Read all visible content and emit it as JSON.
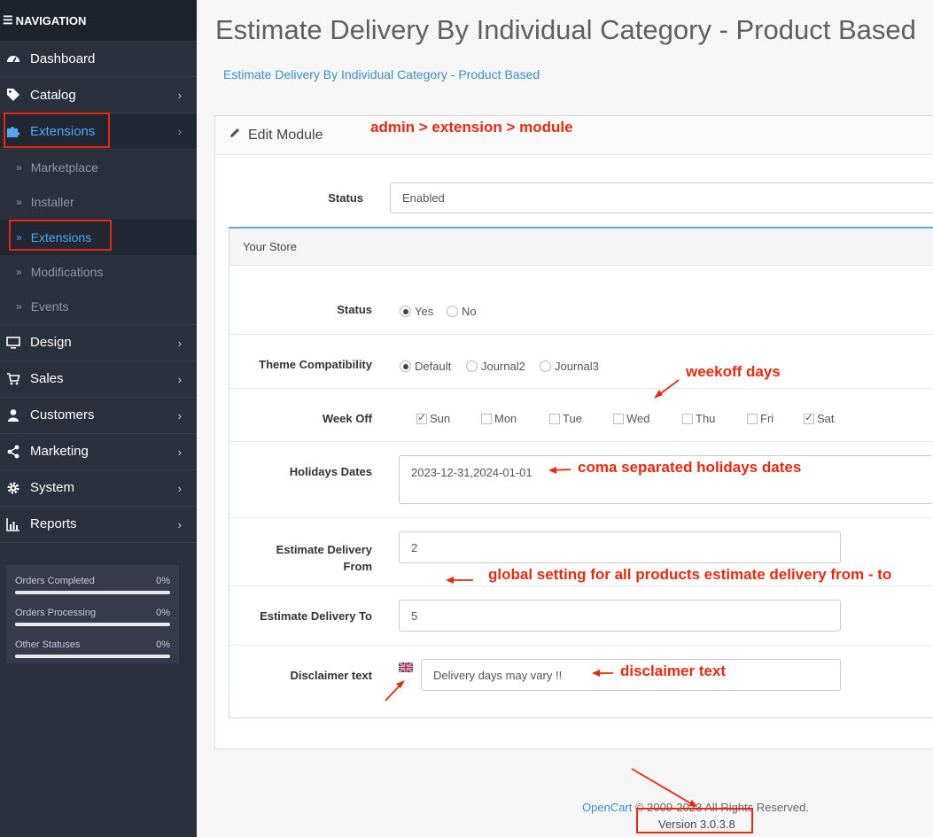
{
  "sidebar": {
    "header": "NAVIGATION",
    "items": [
      {
        "label": "Dashboard",
        "icon": "dashboard-icon"
      },
      {
        "label": "Catalog",
        "icon": "tag-icon"
      },
      {
        "label": "Extensions",
        "icon": "puzzle-icon"
      },
      {
        "label": "Design",
        "icon": "monitor-icon"
      },
      {
        "label": "Sales",
        "icon": "cart-icon"
      },
      {
        "label": "Customers",
        "icon": "user-icon"
      },
      {
        "label": "Marketing",
        "icon": "share-icon"
      },
      {
        "label": "System",
        "icon": "gear-icon"
      },
      {
        "label": "Reports",
        "icon": "bar-chart-icon"
      }
    ],
    "sub_items": [
      "Marketplace",
      "Installer",
      "Extensions",
      "Modifications",
      "Events"
    ],
    "stats": [
      {
        "label": "Orders Completed",
        "value": "0%"
      },
      {
        "label": "Orders Processing",
        "value": "0%"
      },
      {
        "label": "Other Statuses",
        "value": "0%"
      }
    ]
  },
  "page": {
    "title": "Estimate Delivery By Individual Category - Product Based",
    "breadcrumb": "Estimate Delivery By Individual Category - Product Based"
  },
  "panel": {
    "heading": "Edit Module",
    "status_label": "Status",
    "status_value": "Enabled",
    "store_heading": "Your Store"
  },
  "store": {
    "status": {
      "label": "Status",
      "options": [
        "Yes",
        "No"
      ],
      "selected": "Yes"
    },
    "theme": {
      "label": "Theme Compatibility",
      "options": [
        "Default",
        "Journal2",
        "Journal3"
      ],
      "selected": "Default"
    },
    "week_off": {
      "label": "Week Off",
      "days": [
        "Sun",
        "Mon",
        "Tue",
        "Wed",
        "Thu",
        "Fri",
        "Sat"
      ],
      "checked": [
        "Sun",
        "Sat"
      ]
    },
    "holidays": {
      "label": "Holidays Dates",
      "value": "2023-12-31,2024-01-01"
    },
    "from": {
      "label_line1": "Estimate Delivery",
      "label_line2": "From",
      "value": "2"
    },
    "to": {
      "label": "Estimate Delivery To",
      "value": "5"
    },
    "disclaimer": {
      "label": "Disclaimer text",
      "value": "Delivery days may vary !!"
    }
  },
  "annotations": {
    "path": "admin > extension > module",
    "weekoff": "weekoff days",
    "holidays": "coma separated holidays dates",
    "global": "global setting for all products estimate delivery from - to",
    "disclaimer": "disclaimer text"
  },
  "footer": {
    "link": "OpenCart",
    "rest": " © 2009-2023 All Rights Reserved.",
    "version": "Version 3.0.3.8"
  },
  "colors": {
    "accent": "#4ea8f0",
    "annotation": "#e8280f",
    "sidebar": "#2a303c"
  }
}
